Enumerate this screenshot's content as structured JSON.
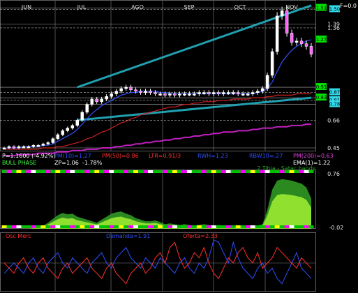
{
  "header": {
    "f_label": "F=0.0"
  },
  "months": [
    "JUN",
    "JUL",
    "AGO",
    "SEP",
    "OCT",
    "NOV"
  ],
  "price_panel": {
    "right_ticks": [
      "1.39",
      "1.36",
      "0.66",
      "0.45"
    ],
    "right_badges": [
      {
        "text": "1.51",
        "color": "#00e000",
        "text_color": "#000000"
      },
      {
        "text": "1.50",
        "color": "#30d8e8",
        "text_color": "#000000"
      },
      {
        "text": "1.27",
        "color": "#00e000",
        "text_color": "#000000"
      },
      {
        "text": "0.91",
        "color": "#00e000",
        "text_color": "#000000"
      },
      {
        "text": "0.87",
        "color": "#30d8e8",
        "text_color": "#000000"
      },
      {
        "text": "0.83",
        "color": "#00e000",
        "text_color": "#000000"
      },
      {
        "text": "0.81",
        "color": "#30d8e8",
        "text_color": "#000000"
      },
      {
        "text": "0.78",
        "color": "#30d8e8",
        "text_color": "#000000"
      }
    ],
    "info_line1": [
      {
        "text": "P=1.1600  (-4.92%)",
        "color": "#ffffff"
      },
      {
        "text": "PM(10)=1.27",
        "color": "#3050ff"
      },
      {
        "text": "PM(50)=0.86",
        "color": "#ff3030"
      },
      {
        "text": "LTR=0.91/3",
        "color": "#ff3030"
      },
      {
        "text": "RWH=1.23",
        "color": "#3050ff"
      },
      {
        "text": "RBW10=.27",
        "color": "#3050ff"
      },
      {
        "text": "PM(200)=0.63",
        "color": "#e040e0"
      }
    ],
    "info_line2": [
      {
        "text": "BULL PHASE",
        "color": "#40ff40"
      },
      {
        "text": "ZP=1.06",
        "color": "#ffffff"
      },
      {
        "text": "-1.78%",
        "color": "#ffffff"
      },
      {
        "text": "EMA(1)=1.22",
        "color": "#ffffff"
      }
    ]
  },
  "tibias_panel": {
    "title": "2 Tibia - Satac bands",
    "top_label": "0.76",
    "bottom_label": "-0.02"
  },
  "flow_panel": {
    "labels": [
      {
        "text": "Osc Merc",
        "color": "#ff3030"
      },
      {
        "text": "Demanda=1.91",
        "color": "#3050ff"
      },
      {
        "text": "Oferta=2.33",
        "color": "#ff3030"
      }
    ]
  },
  "chart_data": {
    "type": "line",
    "x_categories": [
      "JUN",
      "JUL",
      "AGO",
      "SEP",
      "OCT",
      "NOV"
    ],
    "title": "",
    "price": {
      "ylim": [
        0.45,
        1.55
      ],
      "close": [
        0.45,
        0.46,
        0.45,
        0.46,
        0.46,
        0.46,
        0.47,
        0.47,
        0.48,
        0.49,
        0.52,
        0.55,
        0.58,
        0.6,
        0.62,
        0.66,
        0.72,
        0.78,
        0.82,
        0.8,
        0.82,
        0.84,
        0.86,
        0.88,
        0.9,
        0.91,
        0.89,
        0.88,
        0.87,
        0.88,
        0.87,
        0.86,
        0.86,
        0.85,
        0.86,
        0.85,
        0.86,
        0.86,
        0.86,
        0.86,
        0.87,
        0.87,
        0.86,
        0.87,
        0.86,
        0.87,
        0.87,
        0.87,
        0.86,
        0.86,
        0.86,
        0.87,
        0.88,
        0.9,
        1.0,
        1.18,
        1.45,
        1.49,
        1.32,
        1.25,
        1.26,
        1.24,
        1.22,
        1.16
      ],
      "pm10": [
        0.45,
        0.45,
        0.45,
        0.45,
        0.46,
        0.46,
        0.46,
        0.46,
        0.47,
        0.47,
        0.48,
        0.5,
        0.52,
        0.54,
        0.56,
        0.59,
        0.63,
        0.67,
        0.71,
        0.74,
        0.77,
        0.79,
        0.81,
        0.83,
        0.85,
        0.86,
        0.87,
        0.87,
        0.88,
        0.88,
        0.88,
        0.88,
        0.87,
        0.87,
        0.86,
        0.86,
        0.86,
        0.86,
        0.86,
        0.86,
        0.86,
        0.86,
        0.86,
        0.86,
        0.86,
        0.86,
        0.86,
        0.86,
        0.86,
        0.86,
        0.86,
        0.86,
        0.87,
        0.88,
        0.9,
        0.95,
        1.03,
        1.1,
        1.15,
        1.19,
        1.22,
        1.24,
        1.26,
        1.27
      ],
      "pm50": [
        0.44,
        0.44,
        0.44,
        0.44,
        0.44,
        0.44,
        0.44,
        0.44,
        0.45,
        0.45,
        0.45,
        0.46,
        0.46,
        0.47,
        0.48,
        0.49,
        0.5,
        0.52,
        0.53,
        0.55,
        0.57,
        0.58,
        0.6,
        0.62,
        0.64,
        0.65,
        0.67,
        0.68,
        0.7,
        0.71,
        0.72,
        0.73,
        0.74,
        0.75,
        0.76,
        0.76,
        0.77,
        0.78,
        0.78,
        0.79,
        0.79,
        0.8,
        0.8,
        0.8,
        0.81,
        0.81,
        0.81,
        0.82,
        0.82,
        0.82,
        0.82,
        0.83,
        0.83,
        0.83,
        0.84,
        0.84,
        0.85,
        0.85,
        0.85,
        0.85,
        0.86,
        0.86,
        0.86,
        0.86
      ],
      "pm200": [
        0.39,
        0.39,
        0.39,
        0.4,
        0.4,
        0.4,
        0.4,
        0.41,
        0.41,
        0.41,
        0.41,
        0.42,
        0.42,
        0.42,
        0.43,
        0.43,
        0.43,
        0.44,
        0.44,
        0.44,
        0.45,
        0.45,
        0.45,
        0.46,
        0.46,
        0.47,
        0.47,
        0.48,
        0.48,
        0.49,
        0.49,
        0.5,
        0.5,
        0.51,
        0.51,
        0.52,
        0.52,
        0.53,
        0.53,
        0.54,
        0.54,
        0.55,
        0.55,
        0.56,
        0.56,
        0.57,
        0.57,
        0.57,
        0.58,
        0.58,
        0.58,
        0.59,
        0.59,
        0.6,
        0.6,
        0.6,
        0.61,
        0.61,
        0.61,
        0.62,
        0.62,
        0.62,
        0.63,
        0.63
      ],
      "trendline_upper": [
        [
          15,
          0.91
        ],
        [
          63,
          1.53
        ]
      ],
      "trendline_lower": [
        [
          15,
          0.66
        ],
        [
          63,
          0.83
        ]
      ],
      "h_levels": [
        1.51,
        1.5,
        1.39,
        1.36,
        0.91,
        0.87,
        0.83,
        0.81,
        0.78,
        0.66,
        0.45
      ]
    },
    "tibias": {
      "ylim": [
        -0.02,
        0.76
      ],
      "values": [
        0.0,
        0.0,
        0.0,
        0.0,
        0.0,
        0.0,
        0.01,
        0.02,
        0.04,
        0.08,
        0.13,
        0.18,
        0.21,
        0.19,
        0.2,
        0.16,
        0.14,
        0.12,
        0.1,
        0.08,
        0.12,
        0.16,
        0.2,
        0.22,
        0.23,
        0.2,
        0.18,
        0.14,
        0.12,
        0.1,
        0.1,
        0.11,
        0.09,
        0.06,
        0.07,
        0.06,
        0.05,
        0.06,
        0.05,
        0.04,
        0.05,
        0.06,
        0.05,
        0.04,
        0.05,
        0.04,
        0.04,
        0.03,
        0.04,
        0.03,
        0.03,
        0.03,
        0.04,
        0.06,
        0.25,
        0.52,
        0.64,
        0.66,
        0.65,
        0.64,
        0.62,
        0.6,
        0.55,
        0.4
      ]
    },
    "flow": {
      "demanda": [
        0.3,
        0.4,
        0.5,
        0.4,
        0.3,
        0.5,
        0.6,
        0.4,
        0.3,
        0.5,
        0.6,
        0.7,
        0.5,
        0.4,
        0.6,
        0.5,
        0.4,
        0.3,
        0.5,
        0.6,
        0.7,
        0.5,
        0.4,
        0.6,
        0.7,
        0.8,
        0.6,
        0.5,
        0.4,
        0.6,
        0.5,
        0.4,
        0.6,
        0.5,
        0.4,
        0.3,
        0.5,
        0.6,
        0.4,
        0.3,
        0.5,
        0.4,
        0.6,
        0.95,
        0.9,
        0.7,
        0.5,
        0.9,
        0.6,
        0.4,
        0.3,
        0.2,
        0.4,
        0.5,
        0.3,
        0.4,
        0.2,
        0.1,
        0.3,
        0.5,
        0.7,
        0.4,
        0.3,
        0.2
      ],
      "oferta": [
        0.5,
        0.4,
        0.3,
        0.5,
        0.6,
        0.4,
        0.3,
        0.5,
        0.6,
        0.4,
        0.3,
        0.2,
        0.4,
        0.5,
        0.3,
        0.4,
        0.5,
        0.6,
        0.4,
        0.3,
        0.2,
        0.4,
        0.5,
        0.3,
        0.2,
        0.1,
        0.3,
        0.4,
        0.5,
        0.3,
        0.4,
        0.6,
        0.7,
        0.5,
        0.8,
        0.9,
        0.6,
        0.4,
        0.5,
        0.7,
        0.6,
        0.8,
        0.5,
        0.3,
        0.2,
        0.4,
        0.6,
        0.5,
        0.7,
        0.8,
        0.6,
        0.5,
        0.7,
        0.4,
        0.5,
        0.6,
        0.8,
        0.7,
        0.6,
        0.5,
        0.4,
        0.6,
        0.5,
        0.4
      ]
    }
  }
}
